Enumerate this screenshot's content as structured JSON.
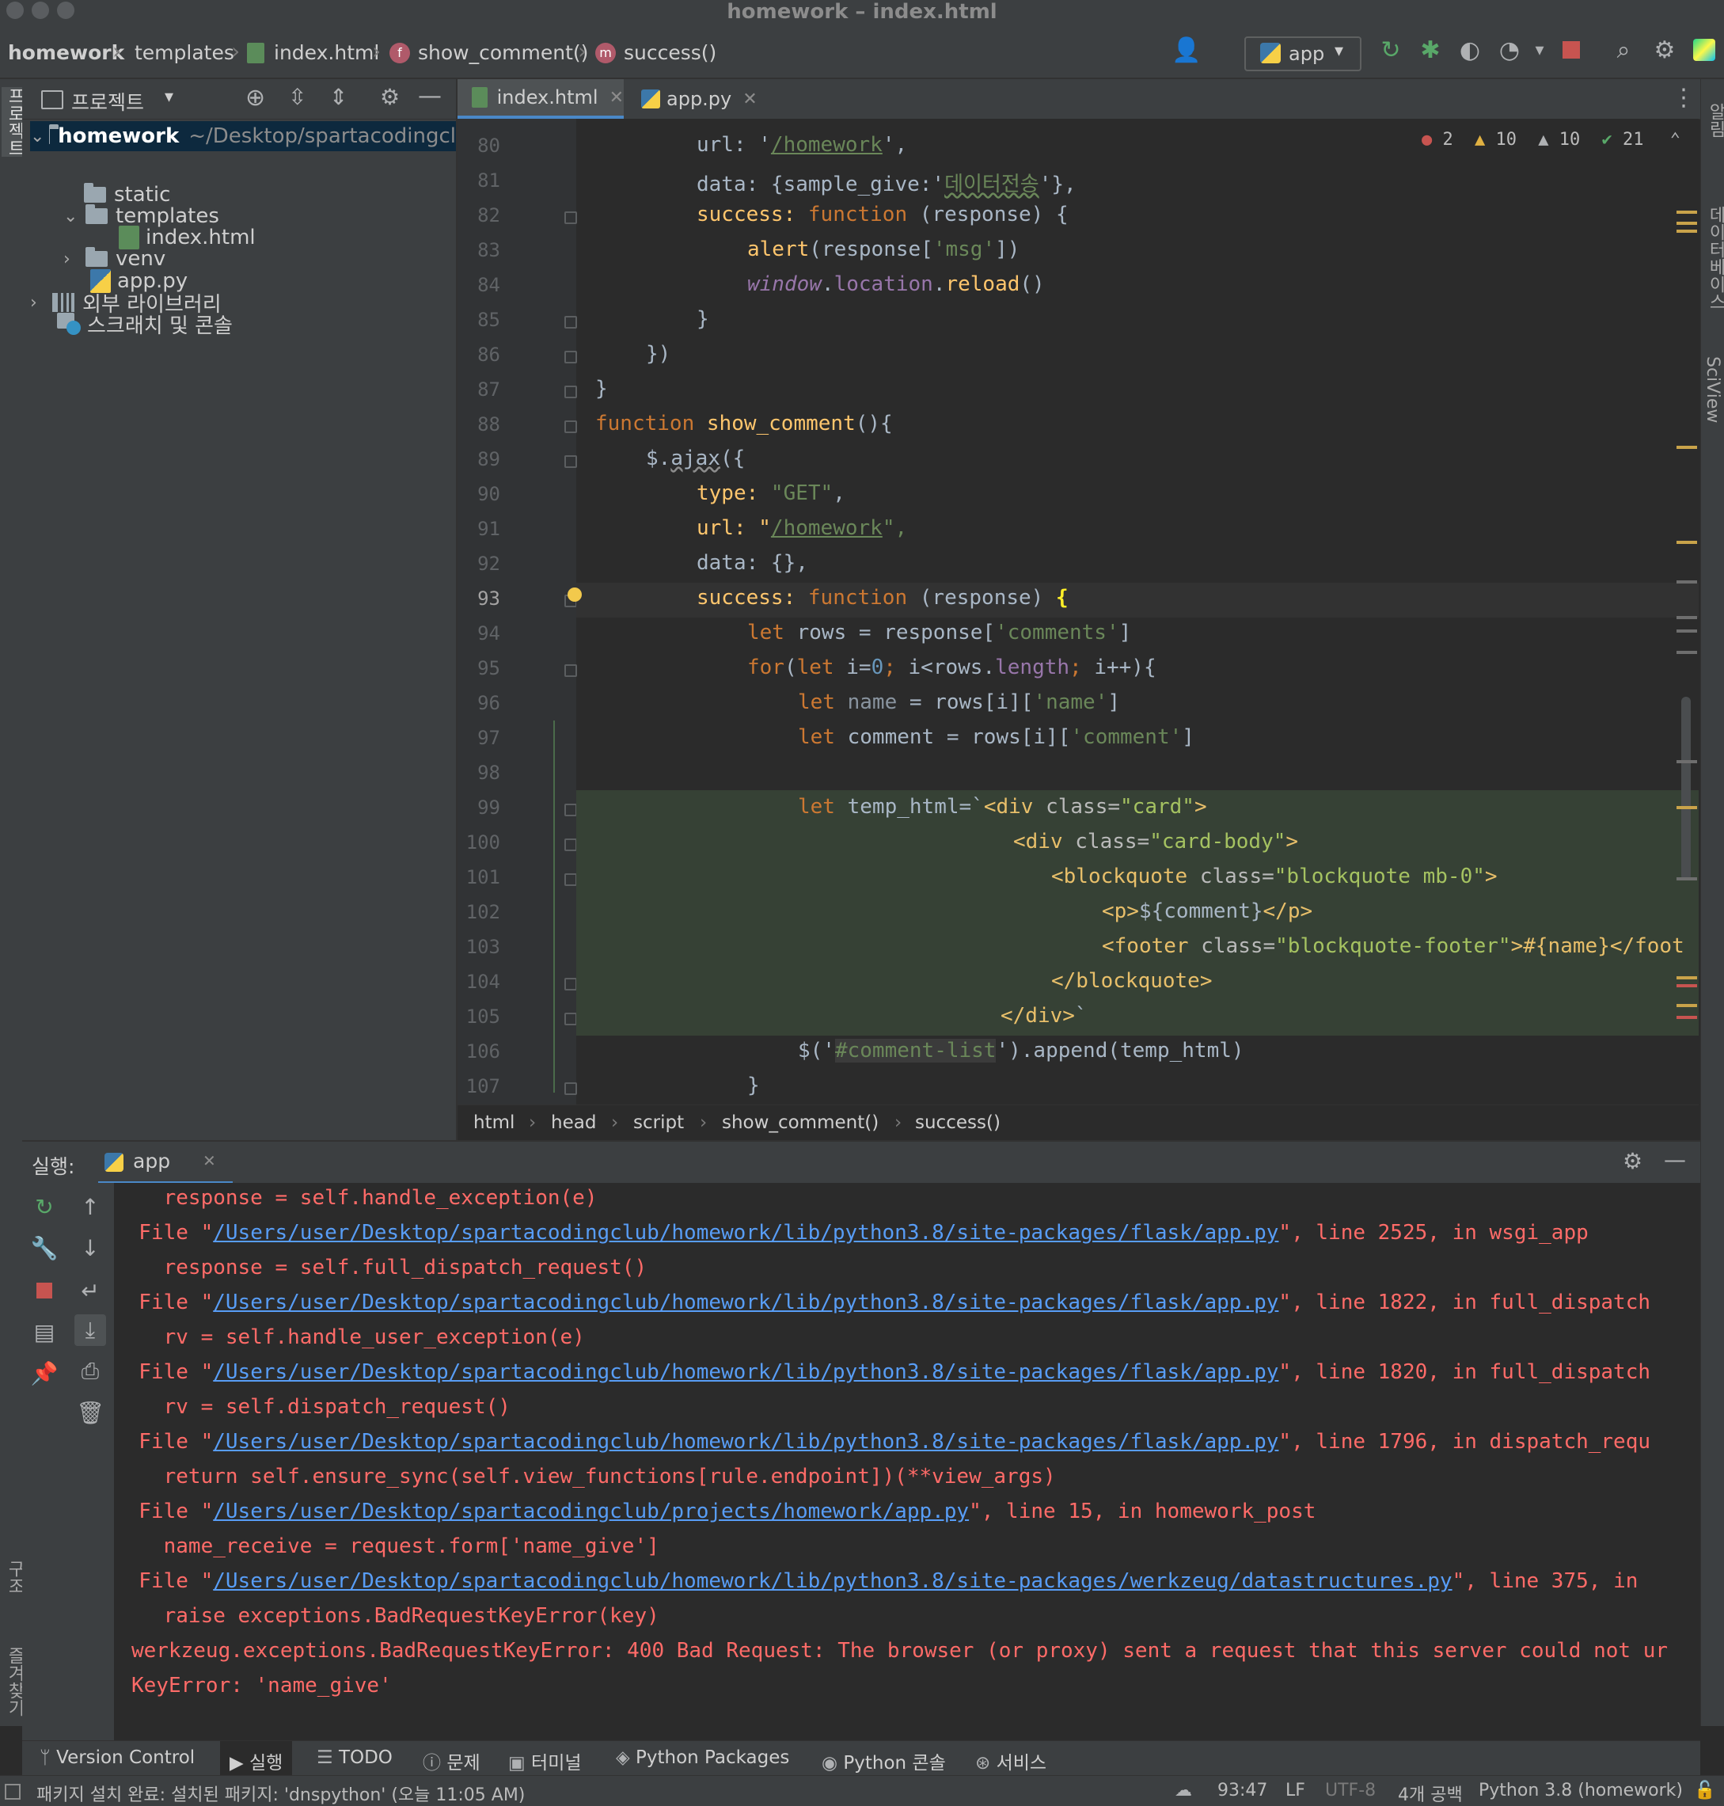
{
  "window": {
    "title": "homework – index.html"
  },
  "navbar": {
    "breadcrumbs": [
      "homework",
      "templates",
      "index.html",
      "show_comment()",
      "success()"
    ],
    "run_config": "app"
  },
  "project": {
    "header": "프로젝트",
    "root_name": "homework",
    "root_path": "~/Desktop/spartacodingcl",
    "items": {
      "static": "static",
      "templates": "templates",
      "index": "index.html",
      "venv": "venv",
      "app": "app.py",
      "ext_libs": "외부 라이브러리",
      "scratches": "스크래치 및 콘솔"
    }
  },
  "tabs": [
    {
      "label": "index.html"
    },
    {
      "label": "app.py"
    }
  ],
  "inspections": {
    "errors": "2",
    "warnings": "10",
    "weak_warnings": "10",
    "ok": "21"
  },
  "editor": {
    "current_line": "93",
    "line_numbers": [
      "80",
      "81",
      "82",
      "83",
      "84",
      "85",
      "86",
      "87",
      "88",
      "89",
      "90",
      "91",
      "92",
      "93",
      "94",
      "95",
      "96",
      "97",
      "98",
      "99",
      "100",
      "101",
      "102",
      "103",
      "104",
      "105",
      "106",
      "107"
    ],
    "code": {
      "l80_a": "url: '",
      "l80_b": "/homework",
      "l80_c": "',",
      "l81_a": "data: {sample_give:'",
      "l81_b": "데이터전송",
      "l81_c": "'},",
      "l82_a": "success: ",
      "l82_b": "function",
      "l82_c": " (response) {",
      "l83_a": "alert",
      "l83_b": "(response[",
      "l83_c": "'msg'",
      "l83_d": "])",
      "l84_a": "window",
      "l84_b": ".",
      "l84_c": "location",
      "l84_d": ".",
      "l84_e": "reload",
      "l84_f": "()",
      "l85": "}",
      "l86": "})",
      "l87": "}",
      "l88_a": "function ",
      "l88_b": "show_comment",
      "l88_c": "(){",
      "l89_a": "$.",
      "l89_b": "ajax",
      "l89_c": "({",
      "l90_a": "type: ",
      "l90_b": "\"GET\"",
      "l90_c": ",",
      "l91_a": "url: \"",
      "l91_b": "/homework",
      "l91_c": "\",",
      "l92": "data: {},",
      "l93_a": "success: ",
      "l93_b": "function",
      "l93_c": " (response) ",
      "l93_d": "{",
      "l94_a": "let ",
      "l94_b": "rows = response[",
      "l94_c": "'comments'",
      "l94_d": "]",
      "l95_a": "for",
      "l95_b": "(",
      "l95_c": "let ",
      "l95_d": "i=",
      "l95_e": "0",
      "l95_f": "; ",
      "l95_g": "i<rows.",
      "l95_h": "length",
      "l95_i": "; ",
      "l95_j": "i++){",
      "l96_a": "let ",
      "l96_b": "name",
      "l96_c": " = rows[i][",
      "l96_d": "'name'",
      "l96_e": "]",
      "l97_a": "let ",
      "l97_b": "comment = rows[i][",
      "l97_c": "'comment'",
      "l97_d": "]",
      "l99_a": "let ",
      "l99_b": "temp_html=`",
      "l99_c": "<div ",
      "l99_d": "class=",
      "l99_e": "\"card\"",
      "l99_f": ">",
      "l100_a": "<div ",
      "l100_b": "class=",
      "l100_c": "\"card-body\"",
      "l100_d": ">",
      "l101_a": "<blockquote ",
      "l101_b": "class=",
      "l101_c": "\"blockquote mb-0\"",
      "l101_d": ">",
      "l102_a": "<p>",
      "l102_b": "${comment}",
      "l102_c": "</p>",
      "l103_a": "<footer ",
      "l103_b": "class=",
      "l103_c": "\"blockquote-footer\"",
      "l103_d": ">#{name}",
      "l103_e": "</foot",
      "l104": "</blockquote>",
      "l105_a": "</div>",
      "l105_b": "`",
      "l106_a": "$('",
      "l106_b": "#comment-list",
      "l106_c": "').append(temp_html)",
      "l107": "}"
    }
  },
  "editor_breadcrumbs": [
    "html",
    "head",
    "script",
    "show_comment()",
    "success()"
  ],
  "run": {
    "label": "실행:",
    "tab": "app",
    "console": {
      "l1": "    response = self.handle_exception(e)",
      "f1_a": "  File \"",
      "f1_path": "/Users/user/Desktop/spartacodingclub/homework/lib/python3.8/site-packages/flask/app.py",
      "f1_b": "\", line 2525, in wsgi_app",
      "l2": "    response = self.full_dispatch_request()",
      "f2_a": "  File \"",
      "f2_path": "/Users/user/Desktop/spartacodingclub/homework/lib/python3.8/site-packages/flask/app.py",
      "f2_b": "\", line 1822, in full_dispatch",
      "l3": "    rv = self.handle_user_exception(e)",
      "f3_a": "  File \"",
      "f3_path": "/Users/user/Desktop/spartacodingclub/homework/lib/python3.8/site-packages/flask/app.py",
      "f3_b": "\", line 1820, in full_dispatch",
      "l4": "    rv = self.dispatch_request()",
      "f4_a": "  File \"",
      "f4_path": "/Users/user/Desktop/spartacodingclub/homework/lib/python3.8/site-packages/flask/app.py",
      "f4_b": "\", line 1796, in dispatch_requ",
      "l5": "    return self.ensure_sync(self.view_functions[rule.endpoint])(**view_args)",
      "f5_a": "  File \"",
      "f5_path": "/Users/user/Desktop/spartacodingclub/projects/homework/app.py",
      "f5_b": "\", line 15, in homework_post",
      "l6": "    name_receive = request.form['name_give']",
      "f6_a": "  File \"",
      "f6_path": "/Users/user/Desktop/spartacodingclub/homework/lib/python3.8/site-packages/werkzeug/datastructures.py",
      "f6_b": "\", line 375, in",
      "l7": "    raise exceptions.BadRequestKeyError(key)",
      "l8": "werkzeug.exceptions.BadRequestKeyError: 400 Bad Request: The browser (or proxy) sent a request that this server could not ur",
      "l9": "KeyError: 'name_give'"
    }
  },
  "tool_windows": [
    "Version Control",
    "실행",
    "TODO",
    "문제",
    "터미널",
    "Python Packages",
    "Python 콘솔",
    "서비스"
  ],
  "status": {
    "message": "패키지 설치 완료: 설치된 패키지: 'dnspython' (오늘 11:05 AM)",
    "position": "93:47",
    "line_sep": "LF",
    "encoding": "UTF-8",
    "indent": "4개 공백",
    "interpreter": "Python 3.8 (homework)"
  },
  "right_strip": {
    "labels": [
      "알림",
      "데이터베이스",
      "SciView"
    ]
  },
  "left_strip": {
    "labels": [
      "프로젝트",
      "구조",
      "즐겨찾기"
    ]
  },
  "colors": {
    "error": "#ff6b68",
    "link": "#589df6",
    "keyword": "#cc7832",
    "string": "#6a8759",
    "function": "#ffc66d"
  }
}
